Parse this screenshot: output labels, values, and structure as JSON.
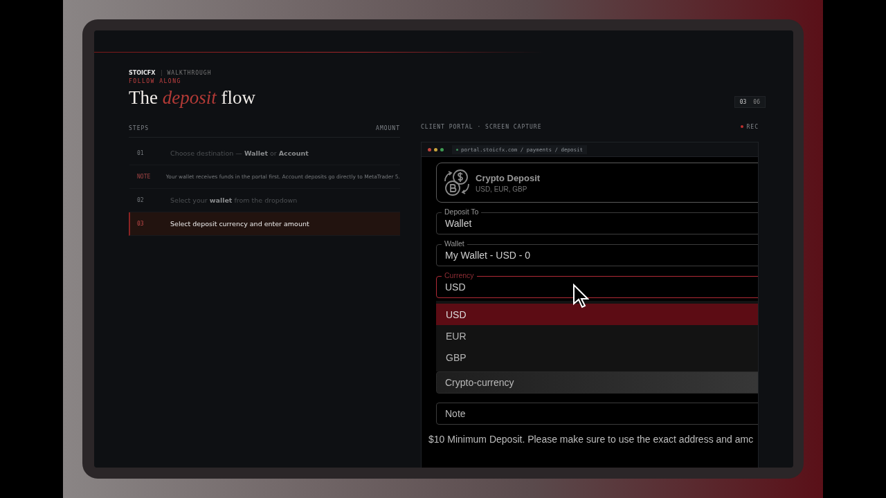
{
  "header": {
    "brand": "STOICFX",
    "section": "WALKTHROUGH",
    "eyebrow": "FOLLOW ALONG",
    "title": "The *deposit* flow",
    "pager": {
      "current": "03",
      "total": "06"
    }
  },
  "steps": {
    "columns": [
      "STEPS",
      "AMOUNT"
    ],
    "items": [
      {
        "number": "01",
        "kind": "step",
        "text": "Choose destination — **Wallet** or **Account**",
        "selected": false
      },
      {
        "number": "NOTE",
        "kind": "note",
        "text": "Your wallet receives funds in the portal first. Account deposits go directly to MetaTrader 5.",
        "selected": false
      },
      {
        "number": "02",
        "kind": "step",
        "text": "Select your **wallet** from the dropdown",
        "selected": false
      },
      {
        "number": "03",
        "kind": "step",
        "text": "Select deposit currency and enter amount",
        "selected": true
      }
    ]
  },
  "capture": {
    "label": "CLIENT PORTAL · SCREEN CAPTURE",
    "status": "REC",
    "url": "portal.stoicfx.com / payments / deposit",
    "card": {
      "title": "Crypto Deposit",
      "subtitle": "USD, EUR, GBP"
    },
    "fields": [
      {
        "label": "Deposit To",
        "value": "Wallet",
        "focused": false
      },
      {
        "label": "Wallet",
        "value": "My Wallet - USD - 0",
        "focused": false
      },
      {
        "label": "Currency",
        "value": "USD",
        "focused": true
      }
    ],
    "options": [
      {
        "label": "USD",
        "selected": true
      },
      {
        "label": "EUR",
        "selected": false
      },
      {
        "label": "GBP",
        "selected": false
      }
    ],
    "more_fields": [
      {
        "placeholder": "Crypto-currency"
      },
      {
        "placeholder": "Note"
      }
    ],
    "notice": "$10 Minimum Deposit. Please make sure to use the exact address and amc"
  }
}
